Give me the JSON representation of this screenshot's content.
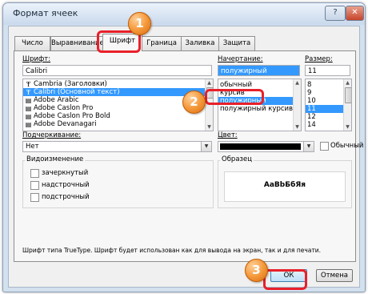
{
  "window": {
    "title": "Формат ячеек",
    "help_label": "?",
    "close_label": "✕"
  },
  "tabs": [
    {
      "label": "Число"
    },
    {
      "label": "Выравнивание"
    },
    {
      "label": "Шрифт",
      "active": true
    },
    {
      "label": "Граница"
    },
    {
      "label": "Заливка"
    },
    {
      "label": "Защита"
    }
  ],
  "font": {
    "label": "Шрифт:",
    "value": "Calibri",
    "list": [
      "Cambria (Заголовки)",
      "Calibri (Основной текст)",
      "Adobe Arabic",
      "Adobe Caslon Pro",
      "Adobe Caslon Pro Bold",
      "Adobe Devanagari"
    ],
    "selected_index": 1
  },
  "style": {
    "label": "Начертание:",
    "value": "полужирный",
    "list": [
      "обычный",
      "курсив",
      "полужирный",
      "полужирный курсив"
    ],
    "selected_index": 2
  },
  "size": {
    "label": "Размер:",
    "value": "11",
    "list": [
      "8",
      "9",
      "10",
      "11",
      "12",
      "14"
    ],
    "selected_index": 3
  },
  "underline": {
    "label": "Подчеркивание:",
    "value": "Нет"
  },
  "color": {
    "label": "Цвет:",
    "normal_label": "Обычный",
    "swatch_color": "#000000"
  },
  "effects": {
    "title": "Видоизменение",
    "items": [
      {
        "label": "зачеркнутый",
        "checked": false
      },
      {
        "label": "надстрочный",
        "checked": false
      },
      {
        "label": "подстрочный",
        "checked": false
      }
    ]
  },
  "preview": {
    "title": "Образец",
    "sample": "АаВbБбЯя"
  },
  "info_text": "Шрифт типа TrueType. Шрифт будет использован как для вывода на экран, так и для печати.",
  "buttons": {
    "ok": "ОК",
    "cancel": "Отмена"
  },
  "annotations": [
    {
      "label": "1"
    },
    {
      "label": "2"
    },
    {
      "label": "3"
    }
  ],
  "colors": {
    "selection": "#3399ff",
    "annotation_badge": "#f59a3c",
    "annotation_outline": "#e8202a"
  }
}
